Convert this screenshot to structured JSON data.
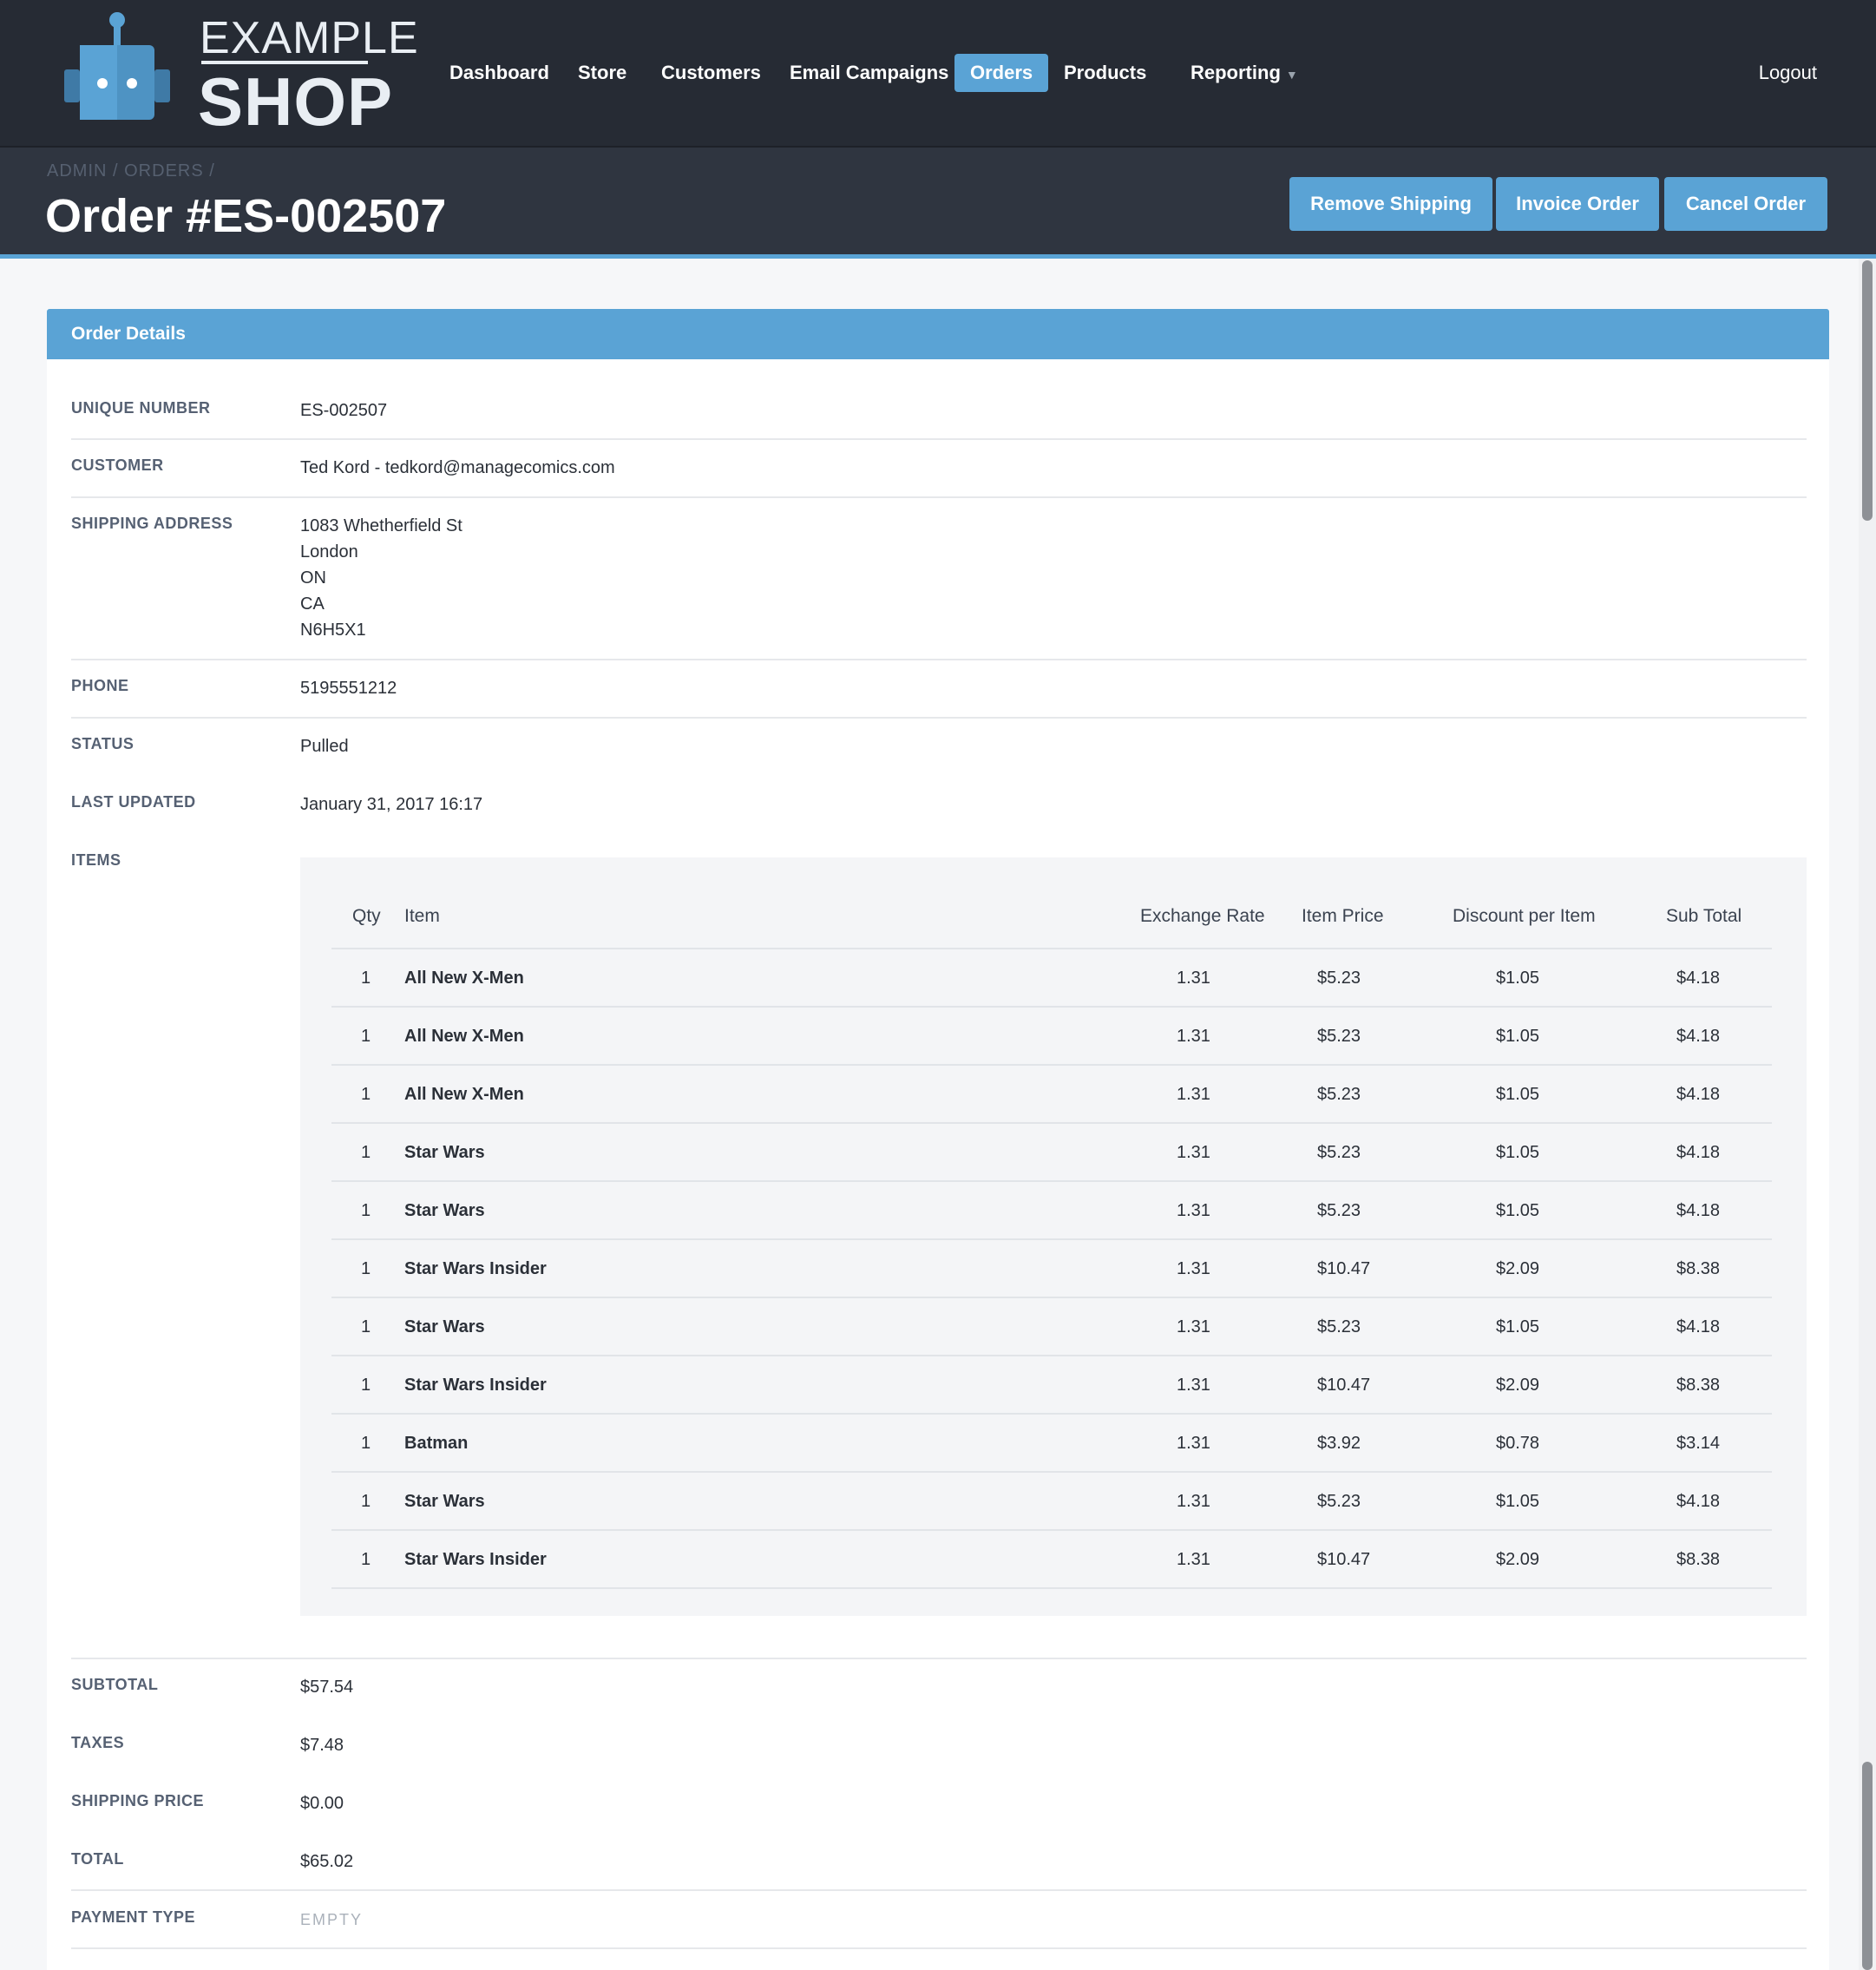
{
  "brand": {
    "line1": "EXAMPLE",
    "line2": "SHOP"
  },
  "nav": {
    "items": [
      {
        "label": "Dashboard"
      },
      {
        "label": "Store"
      },
      {
        "label": "Customers"
      },
      {
        "label": "Email Campaigns"
      },
      {
        "label": "Orders",
        "active": true
      },
      {
        "label": "Products"
      },
      {
        "label": "Reporting"
      }
    ],
    "logout": "Logout"
  },
  "header": {
    "breadcrumb": [
      "ADMIN",
      "ORDERS"
    ],
    "title": "Order #ES-002507",
    "buttons": {
      "remove_shipping": "Remove Shipping",
      "invoice_order": "Invoice Order",
      "cancel_order": "Cancel Order"
    }
  },
  "panel": {
    "heading": "Order Details",
    "fields": {
      "unique_number": {
        "label": "UNIQUE NUMBER",
        "value": "ES-002507"
      },
      "customer": {
        "label": "CUSTOMER",
        "value": "Ted Kord - tedkord@managecomics.com"
      },
      "shipping_address": {
        "label": "SHIPPING ADDRESS",
        "lines": [
          "1083 Whetherfield St",
          "London",
          "ON",
          "CA",
          "N6H5X1"
        ]
      },
      "phone": {
        "label": "PHONE",
        "value": "5195551212"
      },
      "status": {
        "label": "STATUS",
        "value": "Pulled"
      },
      "last_updated": {
        "label": "LAST UPDATED",
        "value": "January 31, 2017 16:17"
      },
      "items": {
        "label": "ITEMS"
      },
      "subtotal": {
        "label": "SUBTOTAL",
        "value": "$57.54"
      },
      "taxes": {
        "label": "TAXES",
        "value": "$7.48"
      },
      "shipping_price": {
        "label": "SHIPPING PRICE",
        "value": "$0.00"
      },
      "total": {
        "label": "TOTAL",
        "value": "$65.02"
      },
      "payment_type": {
        "label": "PAYMENT TYPE",
        "value": "EMPTY"
      }
    },
    "items_table": {
      "columns": {
        "qty": "Qty",
        "item": "Item",
        "exchange_rate": "Exchange Rate",
        "item_price": "Item Price",
        "discount": "Discount per Item",
        "subtotal": "Sub Total"
      },
      "rows": [
        {
          "qty": "1",
          "item": "All New X-Men",
          "rate": "1.31",
          "price": "$5.23",
          "discount": "$1.05",
          "subtotal": "$4.18"
        },
        {
          "qty": "1",
          "item": "All New X-Men",
          "rate": "1.31",
          "price": "$5.23",
          "discount": "$1.05",
          "subtotal": "$4.18"
        },
        {
          "qty": "1",
          "item": "All New X-Men",
          "rate": "1.31",
          "price": "$5.23",
          "discount": "$1.05",
          "subtotal": "$4.18"
        },
        {
          "qty": "1",
          "item": "Star Wars",
          "rate": "1.31",
          "price": "$5.23",
          "discount": "$1.05",
          "subtotal": "$4.18"
        },
        {
          "qty": "1",
          "item": "Star Wars",
          "rate": "1.31",
          "price": "$5.23",
          "discount": "$1.05",
          "subtotal": "$4.18"
        },
        {
          "qty": "1",
          "item": "Star Wars Insider",
          "rate": "1.31",
          "price": "$10.47",
          "discount": "$2.09",
          "subtotal": "$8.38"
        },
        {
          "qty": "1",
          "item": "Star Wars",
          "rate": "1.31",
          "price": "$5.23",
          "discount": "$1.05",
          "subtotal": "$4.18"
        },
        {
          "qty": "1",
          "item": "Star Wars Insider",
          "rate": "1.31",
          "price": "$10.47",
          "discount": "$2.09",
          "subtotal": "$8.38"
        },
        {
          "qty": "1",
          "item": "Batman",
          "rate": "1.31",
          "price": "$3.92",
          "discount": "$0.78",
          "subtotal": "$3.14"
        },
        {
          "qty": "1",
          "item": "Star Wars",
          "rate": "1.31",
          "price": "$5.23",
          "discount": "$1.05",
          "subtotal": "$4.18"
        },
        {
          "qty": "1",
          "item": "Star Wars Insider",
          "rate": "1.31",
          "price": "$10.47",
          "discount": "$2.09",
          "subtotal": "$8.38"
        }
      ]
    }
  },
  "colors": {
    "navbar": "#262b34",
    "header": "#2f3540",
    "accent": "#5aa3d5",
    "label": "#566173"
  }
}
